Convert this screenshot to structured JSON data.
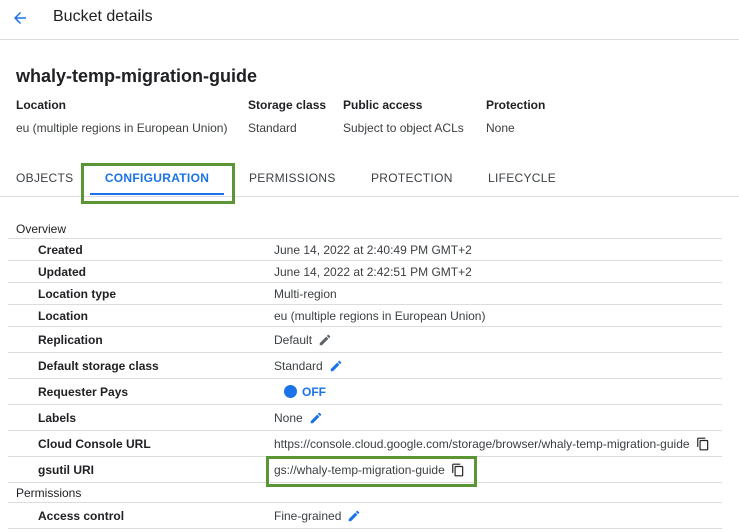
{
  "header": {
    "title": "Bucket details",
    "back_icon": "arrow-back-icon"
  },
  "bucket": {
    "name": "whaly-temp-migration-guide"
  },
  "summary": [
    {
      "label": "Location",
      "value": "eu (multiple regions in European Union)"
    },
    {
      "label": "Storage class",
      "value": "Standard"
    },
    {
      "label": "Public access",
      "value": "Subject to object ACLs"
    },
    {
      "label": "Protection",
      "value": "None"
    }
  ],
  "tabs": [
    "OBJECTS",
    "CONFIGURATION",
    "PERMISSIONS",
    "PROTECTION",
    "LIFECYCLE"
  ],
  "active_tab": "CONFIGURATION",
  "sections": {
    "overview": "Overview",
    "permissions": "Permissions"
  },
  "overview_rows": {
    "created": {
      "key": "Created",
      "value": "June 14, 2022 at 2:40:49 PM GMT+2"
    },
    "updated": {
      "key": "Updated",
      "value": "June 14, 2022 at 2:42:51 PM GMT+2"
    },
    "location_type": {
      "key": "Location type",
      "value": "Multi-region"
    },
    "location": {
      "key": "Location",
      "value": "eu (multiple regions in European Union)"
    },
    "replication": {
      "key": "Replication",
      "value": "Default"
    },
    "default_storage_class": {
      "key": "Default storage class",
      "value": "Standard"
    },
    "requester_pays": {
      "key": "Requester Pays",
      "value": "OFF"
    },
    "labels": {
      "key": "Labels",
      "value": "None"
    },
    "cloud_console_url": {
      "key": "Cloud Console URL",
      "value": "https://console.cloud.google.com/storage/browser/whaly-temp-migration-guide"
    },
    "gsutil_uri": {
      "key": "gsutil URI",
      "value": "gs://whaly-temp-migration-guide"
    }
  },
  "permission_rows": {
    "access_control": {
      "key": "Access control",
      "value": "Fine-grained"
    }
  },
  "colors": {
    "accent": "#1a73e8",
    "highlight": "#5a9734",
    "divider": "#dadce0",
    "edit_icon_blue": "#1a73e8",
    "edit_icon_gray": "#5f6368"
  }
}
